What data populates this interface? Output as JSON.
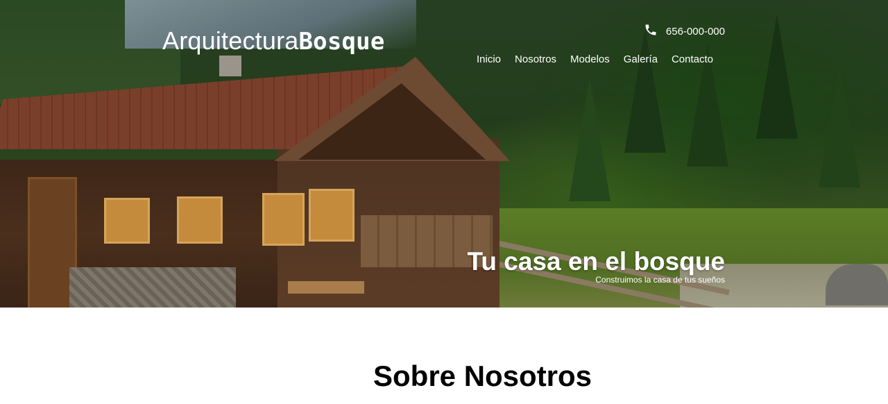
{
  "header": {
    "logo_light": "Arquitectura",
    "logo_bold": "Bosque",
    "phone": "656-000-000",
    "phone_icon": "phone-icon"
  },
  "nav": {
    "items": [
      {
        "label": "Inicio"
      },
      {
        "label": "Nosotros"
      },
      {
        "label": "Modelos"
      },
      {
        "label": "Galería"
      },
      {
        "label": "Contacto"
      }
    ]
  },
  "hero": {
    "title": "Tu casa en el bosque",
    "subtitle": "Construimos la casa de tus sueños"
  },
  "about": {
    "title": "Sobre Nosotros"
  }
}
